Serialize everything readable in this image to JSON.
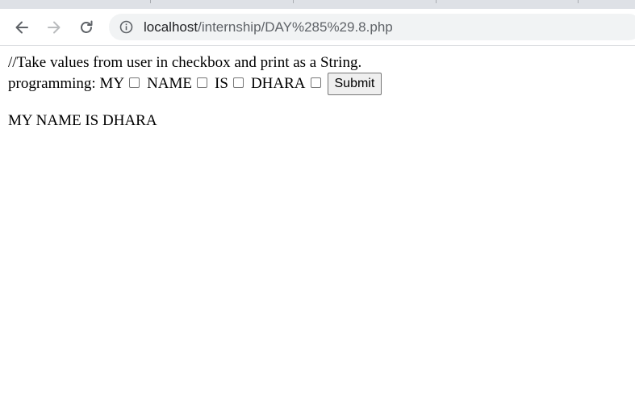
{
  "browser": {
    "url_host": "localhost",
    "url_path": "/internship/DAY%285%29.8.php"
  },
  "page": {
    "comment_line": "//Take values from user in checkbox and print as a String.",
    "form_label": "programming:",
    "checkboxes": [
      {
        "label": "MY",
        "checked": false
      },
      {
        "label": "NAME",
        "checked": false
      },
      {
        "label": "IS",
        "checked": false
      },
      {
        "label": "DHARA",
        "checked": false
      }
    ],
    "submit_label": "Submit",
    "output_text": "MY NAME IS DHARA"
  }
}
